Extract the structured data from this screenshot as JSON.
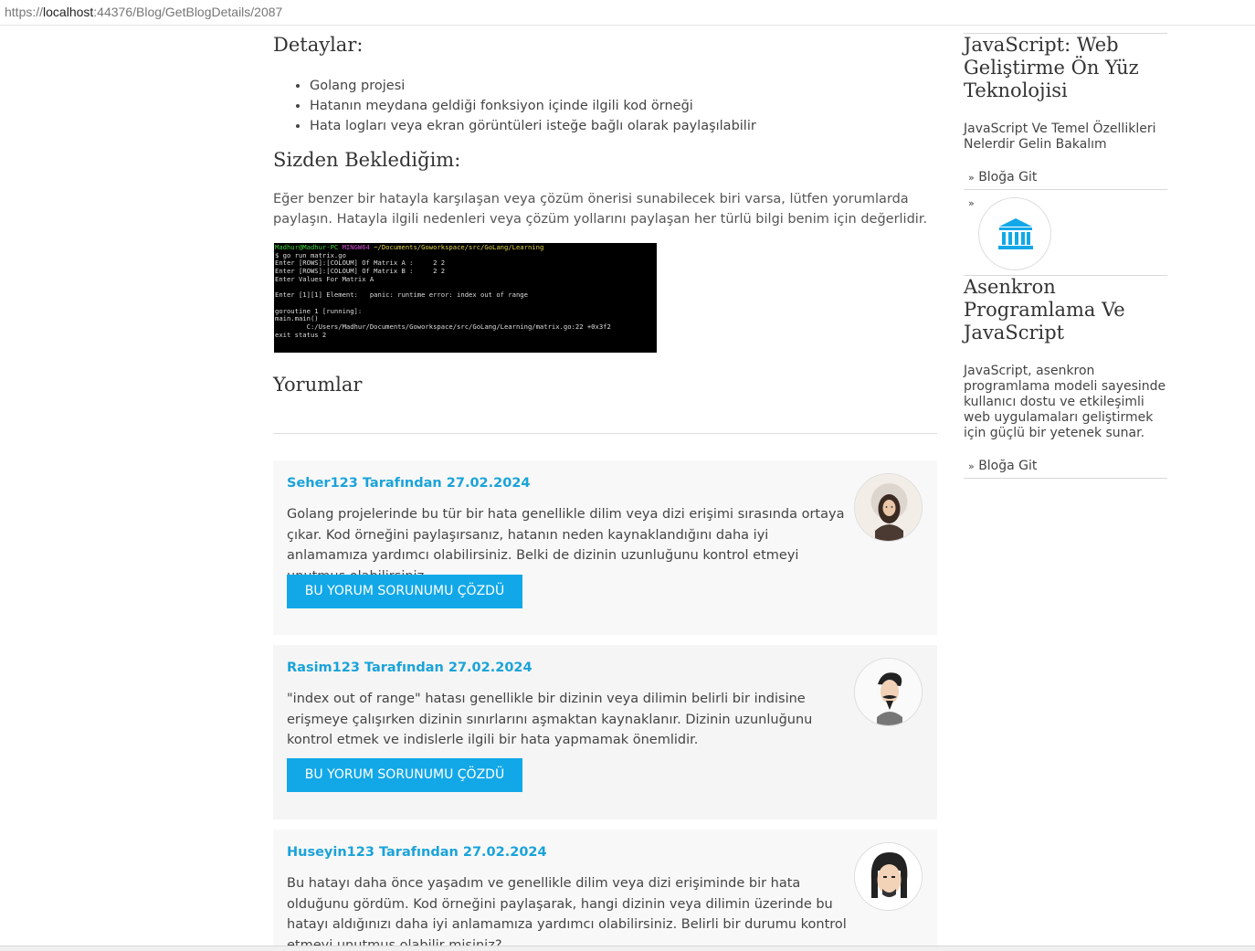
{
  "browser": {
    "url_prefix": "https://",
    "url_host": "localhost",
    "url_rest": ":44376/Blog/GetBlogDetails/2087"
  },
  "main": {
    "details_title": "Detaylar:",
    "details_items": [
      "Golang projesi",
      "Hatanın meydana geldiği fonksiyon içinde ilgili kod örneği",
      "Hata logları veya ekran görüntüleri isteğe bağlı olarak paylaşılabilir"
    ],
    "expect_title": "Sizden Beklediğim:",
    "expect_text": "Eğer benzer bir hatayla karşılaşan veya çözüm önerisi sunabilecek biri varsa, lütfen yorumlarda paylaşın. Hatayla ilgili nedenleri veya çözüm yollarını paylaşan her türlü bilgi benim için değerlidir.",
    "terminal": {
      "prompt_user": "Madhur@Madhur-PC",
      "prompt_env": "MINGW64",
      "prompt_path": "~/Documents/Goworkspace/src/GoLang/Learning",
      "lines": [
        "$ go run matrix.go",
        "Enter [ROWS]:[COLOUM] Of Matrix A :     2 2",
        "Enter [ROWS]:[COLOUM] Of Matrix B :     2 2",
        "Enter Values For Matrix A",
        "",
        "Enter [1][1] Element:   panic: runtime error: index out of range",
        "",
        "goroutine 1 [running]:",
        "main.main()",
        "        C:/Users/Madhur/Documents/Goworkspace/src/GoLang/Learning/matrix.go:22 +0x3f2",
        "exit status 2"
      ]
    },
    "comments_title": "Yorumlar"
  },
  "comments": [
    {
      "title": "Seher123 Tarafından 27.02.2024",
      "text": "Golang projelerinde bu tür bir hata genellikle dilim veya dizi erişimi sırasında ortaya çıkar. Kod örneğini paylaşırsanız, hatanın neden kaynaklandığını daha iyi anlamamıza yardımcı olabilirsiniz. Belki de dizinin uzunluğunu kontrol etmeyi unutmuş olabilirsiniz.",
      "button": "BU YORUM SORUNUMU ÇÖZDÜ"
    },
    {
      "title": "Rasim123 Tarafından 27.02.2024",
      "text": "\"index out of range\" hatası genellikle bir dizinin veya dilimin belirli bir indisine erişmeye çalışırken dizinin sınırlarını aşmaktan kaynaklanır. Dizinin uzunluğunu kontrol etmek ve indislerle ilgili bir hata yapmamak önemlidir.",
      "button": "BU YORUM SORUNUMU ÇÖZDÜ"
    },
    {
      "title": "Huseyin123 Tarafından 27.02.2024",
      "text": "Bu hatayı daha önce yaşadım ve genellikle dilim veya dizi erişiminde bir hata olduğunu gördüm. Kod örneğini paylaşarak, hangi dizinin veya dilimin üzerinde bu hatayı aldığınızı daha iyi anlamamıza yardımcı olabilirsiniz. Belirli bir durumu kontrol etmeyi unutmuş olabilir misiniz?"
    }
  ],
  "sidebar": {
    "post1_title": "JavaScript: Web Geliştirme Ön Yüz Teknolojisi",
    "post1_desc": "JavaScript Ve Temel Özellikleri Nelerdir Gelin Bakalım",
    "post1_link": "Bloğa Git",
    "chevron": "»",
    "post2_title": "Asenkron Programlama Ve JavaScript",
    "post2_desc": "JavaScript, asenkron programlama modeli sayesinde kullanıcı dostu ve etkileşimli web uygulamaları geliştirmek için güçlü bir yetenek sunar.",
    "post2_link": "Bloğa Git"
  },
  "colors": {
    "accent": "#12a8e8",
    "title_link": "#1aa3d9"
  }
}
